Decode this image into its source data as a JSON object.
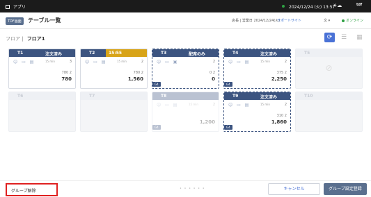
{
  "status_bar": {
    "app_label": "アプリ",
    "datetime": "2024/12/24 (火) 13:57",
    "weather_icon": "sun-cloud-icon",
    "user_badge": "tdf"
  },
  "header": {
    "brand_tag": "TDF画面",
    "title": "テーブル一覧",
    "store_info": "店長 | 営業日 2024/12/24(火)",
    "support_label": "サポートサイト",
    "lang_label": "文 ▾",
    "online_label": "オンライン"
  },
  "breadcrumb": {
    "root": "フロア",
    "current": "フロア1"
  },
  "tables": [
    {
      "num": "T1",
      "status": "注文済み",
      "head_color": "#3c5480",
      "time": "15 min",
      "count": "3",
      "line1": "780  2",
      "total": "780",
      "group": "",
      "style": "normal"
    },
    {
      "num": "T2",
      "status": "15:55",
      "head_color": "#d8a418",
      "time": "15 min",
      "count": "2",
      "line1": "780  2",
      "total": "1,560",
      "group": "",
      "style": "normal"
    },
    {
      "num": "T3",
      "status": "配席のみ",
      "head_color": "#3c5480",
      "time": "",
      "count": "2",
      "line1": "0  2",
      "total": "0",
      "group": "G4",
      "style": "dashed"
    },
    {
      "num": "T4",
      "status": "注文済み",
      "head_color": "#3c5480",
      "time": "15 min",
      "count": "2",
      "line1": "375  2",
      "total": "2,250",
      "group": "G4",
      "style": "dashed"
    },
    {
      "num": "T5",
      "status": "",
      "head_color": "#eef0f4",
      "time": "",
      "count": "",
      "line1": "",
      "total": "",
      "group": "",
      "style": "ghost"
    },
    {
      "num": "T6",
      "status": "",
      "head_color": "#eef0f4",
      "time": "",
      "count": "",
      "line1": "",
      "total": "",
      "group": "",
      "style": "ghost"
    },
    {
      "num": "T7",
      "status": "",
      "head_color": "#eef0f4",
      "time": "",
      "count": "",
      "line1": "",
      "total": "",
      "group": "",
      "style": "ghost"
    },
    {
      "num": "T8",
      "status": "",
      "head_color": "#3c5480",
      "time": "15 min",
      "count": "2",
      "line1": "",
      "total": "1,200",
      "group": "G4",
      "style": "dim"
    },
    {
      "num": "T9",
      "status": "注文済み",
      "head_color": "#3c5480",
      "time": "15 min",
      "count": "2",
      "line1": "310  2",
      "total": "1,860",
      "group": "G4",
      "style": "dashed"
    },
    {
      "num": "T10",
      "status": "",
      "head_color": "#eef0f4",
      "time": "",
      "count": "",
      "line1": "",
      "total": "",
      "group": "",
      "style": "ghost"
    }
  ],
  "footer": {
    "group_release_label": "グループ解除",
    "pager": "• • • • • •",
    "cancel_label": "キャンセル",
    "submit_label": "グループ設定登録"
  }
}
